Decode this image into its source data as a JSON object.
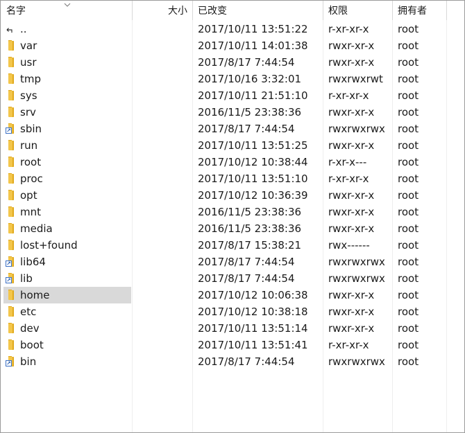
{
  "columns": {
    "name": "名字",
    "size": "大小",
    "modified": "已改变",
    "permissions": "权限",
    "owner": "拥有者"
  },
  "files": [
    {
      "name": "..",
      "modified": "2017/10/11 13:51:22",
      "permissions": "r-xr-xr-x",
      "owner": "root",
      "type": "parent"
    },
    {
      "name": "var",
      "modified": "2017/10/11 14:01:38",
      "permissions": "rwxr-xr-x",
      "owner": "root",
      "type": "folder"
    },
    {
      "name": "usr",
      "modified": "2017/8/17 7:44:54",
      "permissions": "rwxr-xr-x",
      "owner": "root",
      "type": "folder"
    },
    {
      "name": "tmp",
      "modified": "2017/10/16 3:32:01",
      "permissions": "rwxrwxrwt",
      "owner": "root",
      "type": "folder"
    },
    {
      "name": "sys",
      "modified": "2017/10/11 21:51:10",
      "permissions": "r-xr-xr-x",
      "owner": "root",
      "type": "folder"
    },
    {
      "name": "srv",
      "modified": "2016/11/5 23:38:36",
      "permissions": "rwxr-xr-x",
      "owner": "root",
      "type": "folder"
    },
    {
      "name": "sbin",
      "modified": "2017/8/17 7:44:54",
      "permissions": "rwxrwxrwx",
      "owner": "root",
      "type": "link"
    },
    {
      "name": "run",
      "modified": "2017/10/11 13:51:25",
      "permissions": "rwxr-xr-x",
      "owner": "root",
      "type": "folder"
    },
    {
      "name": "root",
      "modified": "2017/10/12 10:38:44",
      "permissions": "r-xr-x---",
      "owner": "root",
      "type": "folder"
    },
    {
      "name": "proc",
      "modified": "2017/10/11 13:51:10",
      "permissions": "r-xr-xr-x",
      "owner": "root",
      "type": "folder"
    },
    {
      "name": "opt",
      "modified": "2017/10/12 10:36:39",
      "permissions": "rwxr-xr-x",
      "owner": "root",
      "type": "folder"
    },
    {
      "name": "mnt",
      "modified": "2016/11/5 23:38:36",
      "permissions": "rwxr-xr-x",
      "owner": "root",
      "type": "folder"
    },
    {
      "name": "media",
      "modified": "2016/11/5 23:38:36",
      "permissions": "rwxr-xr-x",
      "owner": "root",
      "type": "folder"
    },
    {
      "name": "lost+found",
      "modified": "2017/8/17 15:38:21",
      "permissions": "rwx------",
      "owner": "root",
      "type": "folder"
    },
    {
      "name": "lib64",
      "modified": "2017/8/17 7:44:54",
      "permissions": "rwxrwxrwx",
      "owner": "root",
      "type": "link"
    },
    {
      "name": "lib",
      "modified": "2017/8/17 7:44:54",
      "permissions": "rwxrwxrwx",
      "owner": "root",
      "type": "link"
    },
    {
      "name": "home",
      "modified": "2017/10/12 10:06:38",
      "permissions": "rwxr-xr-x",
      "owner": "root",
      "type": "folder",
      "selected": true
    },
    {
      "name": "etc",
      "modified": "2017/10/12 10:38:18",
      "permissions": "rwxr-xr-x",
      "owner": "root",
      "type": "folder"
    },
    {
      "name": "dev",
      "modified": "2017/10/11 13:51:14",
      "permissions": "rwxr-xr-x",
      "owner": "root",
      "type": "folder"
    },
    {
      "name": "boot",
      "modified": "2017/10/11 13:51:41",
      "permissions": "r-xr-xr-x",
      "owner": "root",
      "type": "folder"
    },
    {
      "name": "bin",
      "modified": "2017/8/17 7:44:54",
      "permissions": "rwxrwxrwx",
      "owner": "root",
      "type": "link"
    }
  ],
  "colors": {
    "folder": "#f3c64b",
    "selection": "#d9d9d9",
    "link_badge": "#3a6fc4"
  }
}
